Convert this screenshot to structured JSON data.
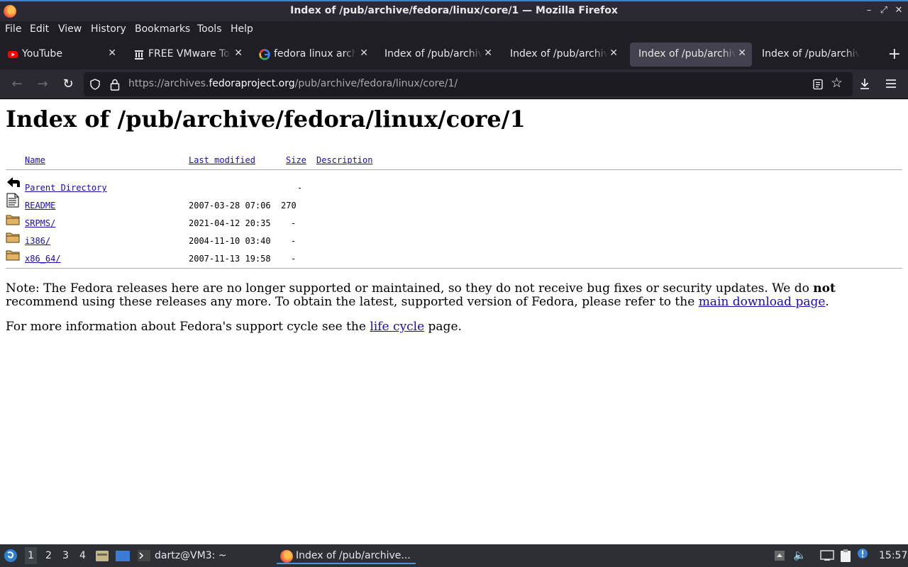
{
  "window": {
    "title": "Index of /pub/archive/fedora/linux/core/1 — Mozilla Firefox"
  },
  "menu": [
    "File",
    "Edit",
    "View",
    "History",
    "Bookmarks",
    "Tools",
    "Help"
  ],
  "tabs": [
    {
      "label": "YouTube",
      "icon": "youtube-icon",
      "active": false
    },
    {
      "label": "FREE VMware Tools",
      "icon": "archive-icon",
      "active": false
    },
    {
      "label": "fedora linux archive",
      "icon": "google-icon",
      "active": false
    },
    {
      "label": "Index of /pub/archive",
      "icon": "",
      "active": false
    },
    {
      "label": "Index of /pub/archive",
      "icon": "",
      "active": false
    },
    {
      "label": "Index of /pub/archive",
      "icon": "",
      "active": true
    },
    {
      "label": "Index of /pub/archive",
      "icon": "",
      "active": false
    }
  ],
  "urlbar": {
    "prefix": "https://archives.",
    "host": "fedoraproject.org",
    "path": "/pub/archive/fedora/linux/core/1/"
  },
  "page": {
    "heading": "Index of /pub/archive/fedora/linux/core/1",
    "columns": {
      "name": "Name",
      "modified": "Last modified",
      "size": "Size",
      "description": "Description"
    },
    "rows": [
      {
        "name": "Parent Directory",
        "modified": "",
        "size": "-",
        "icon": "back-icon"
      },
      {
        "name": "README",
        "modified": "2007-03-28 07:06",
        "size": "270",
        "icon": "text-file-icon"
      },
      {
        "name": "SRPMS/",
        "modified": "2021-04-12 20:35",
        "size": "-",
        "icon": "folder-icon"
      },
      {
        "name": "i386/",
        "modified": "2004-11-10 03:40",
        "size": "-",
        "icon": "folder-icon"
      },
      {
        "name": "x86_64/",
        "modified": "2007-11-13 19:58",
        "size": "-",
        "icon": "folder-icon"
      }
    ],
    "note_part1": "Note: The Fedora releases here are no longer supported or maintained, so they do not receive bug fixes or security updates. We do ",
    "note_bold": "not",
    "note_part2": " recommend using these releases any more. To obtain the latest, supported version of Fedora, please refer to the ",
    "note_link": "main download page",
    "note_end": ".",
    "lifecycle_part1": "For more information about Fedora's support cycle see the ",
    "lifecycle_link": "life cycle",
    "lifecycle_end": " page."
  },
  "taskbar": {
    "workspaces": [
      "1",
      "2",
      "3",
      "4"
    ],
    "terminal_task": "dartz@VM3: ~",
    "browser_task": "Index of /pub/archive...",
    "clock": "15:57"
  }
}
